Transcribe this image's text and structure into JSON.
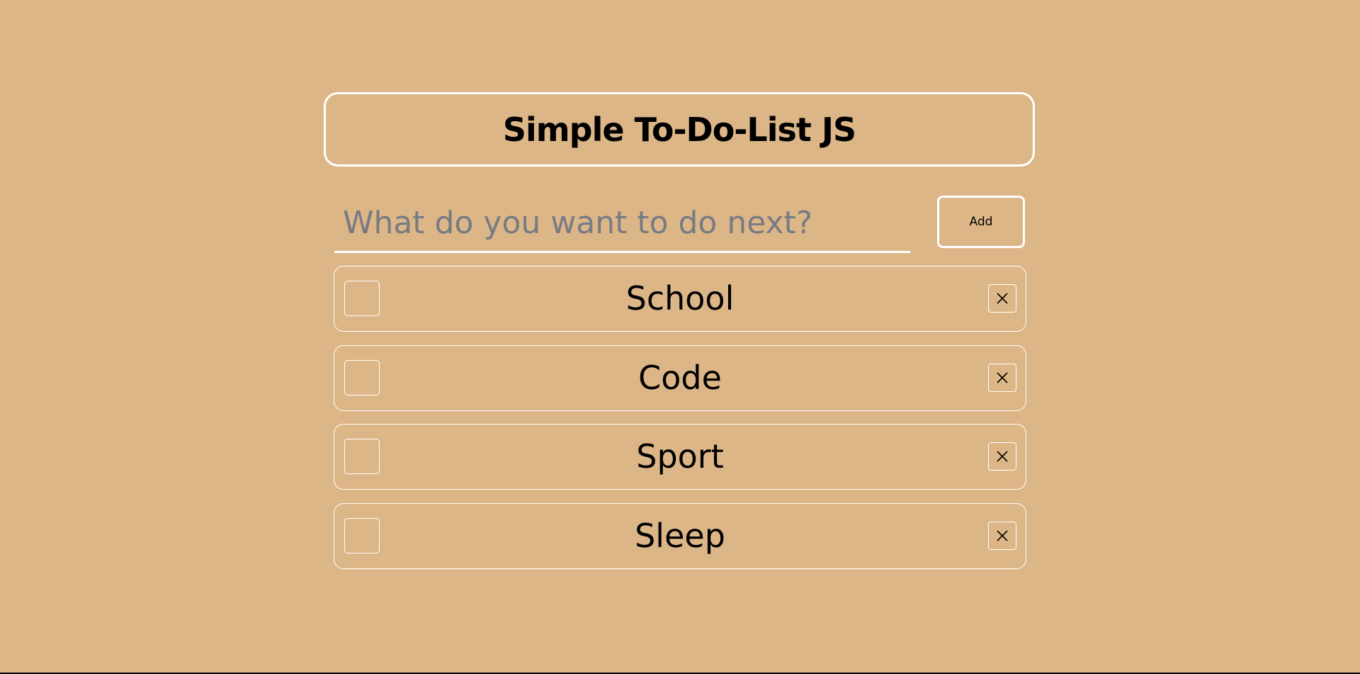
{
  "header": {
    "title": "Simple To-Do-List JS"
  },
  "form": {
    "input_value": "",
    "input_placeholder": "What do you want to do next?",
    "add_label": "Add"
  },
  "todos": [
    {
      "label": "School",
      "checked": false,
      "delete_icon": "close-icon"
    },
    {
      "label": "Code",
      "checked": false,
      "delete_icon": "close-icon"
    },
    {
      "label": "Sport",
      "checked": false,
      "delete_icon": "close-icon"
    },
    {
      "label": "Sleep",
      "checked": false,
      "delete_icon": "close-icon"
    }
  ],
  "colors": {
    "background": "#ddb688",
    "border": "#ffffff",
    "text": "#000000",
    "placeholder": "#777b84"
  }
}
